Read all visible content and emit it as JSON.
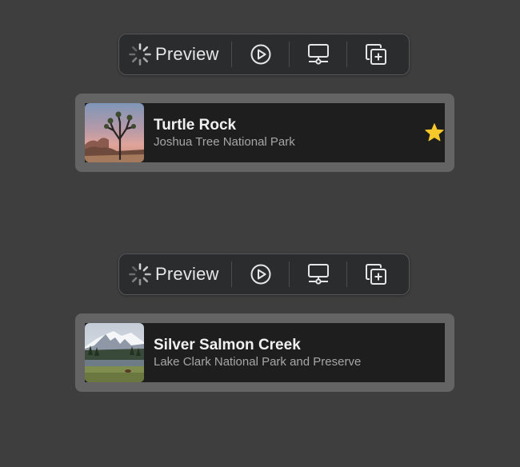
{
  "colors": {
    "background": "#3e3e3e",
    "toolbar_bg": "#2b2c2e",
    "card_frame": "#646464",
    "row_bg": "#1e1e1e",
    "star": "#f7c82b"
  },
  "previews": [
    {
      "toolbar": {
        "preview_label": "Preview",
        "icons": [
          "loading-spinner-icon",
          "play-icon",
          "device-settings-icon",
          "duplicate-icon"
        ]
      },
      "landmark": {
        "name": "Turtle Rock",
        "park": "Joshua Tree National Park",
        "thumbnail": "joshua-tree-thumbnail",
        "is_favorite": true
      }
    },
    {
      "toolbar": {
        "preview_label": "Preview",
        "icons": [
          "loading-spinner-icon",
          "play-icon",
          "device-settings-icon",
          "duplicate-icon"
        ]
      },
      "landmark": {
        "name": "Silver Salmon Creek",
        "park": "Lake Clark National Park and Preserve",
        "thumbnail": "mountain-meadow-thumbnail",
        "is_favorite": false
      }
    }
  ]
}
